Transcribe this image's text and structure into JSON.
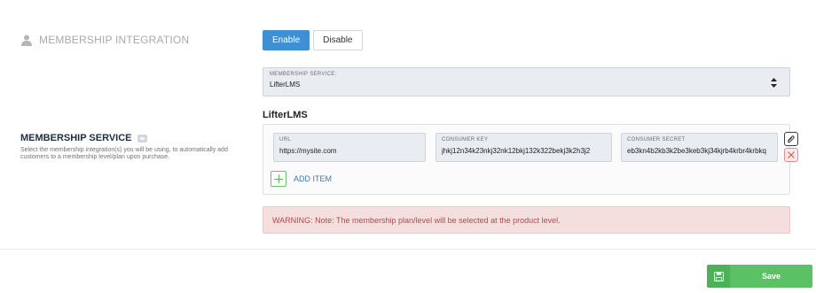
{
  "header": {
    "icon": "user-icon",
    "title": "MEMBERSHIP INTEGRATION"
  },
  "toggle": {
    "enable_label": "Enable",
    "disable_label": "Disable",
    "selected": "Enable"
  },
  "membership_select": {
    "label": "MEMBERSHIP SERVICE:",
    "value": "LifterLMS",
    "icon": "sort-icon"
  },
  "provider_title": "LifterLMS",
  "membership_service": {
    "title": "MEMBERSHIP SERVICE",
    "help_icon": "help-icon",
    "description": "Select the membership integration(s) you will be using, to automatically add customers to a membership level/plan upon purchase."
  },
  "item": {
    "url_label": "URL",
    "url_value": "https://mysite.com",
    "key_label": "CONSUMER KEY",
    "key_value": "jhkj12n34k23nkj32nk12bkj132k322bekj3k2h3j2",
    "secret_label": "CONSUMER SECRET",
    "secret_value": "eb3kn4b2kb3k2be3keb3kj34kjrb4krbr4krbkq"
  },
  "add_item_label": "ADD ITEM",
  "warning": "WARNING: Note: The membership plan/level will be selected at the product level.",
  "save": {
    "label": "Save",
    "icon": "floppy-disk-icon"
  },
  "colors": {
    "enable_active": "#3f8fd4",
    "save_green": "#5cc064",
    "warning_bg": "#f5dede",
    "warning_text": "#b04a4a",
    "link_blue": "#3a78b5"
  }
}
